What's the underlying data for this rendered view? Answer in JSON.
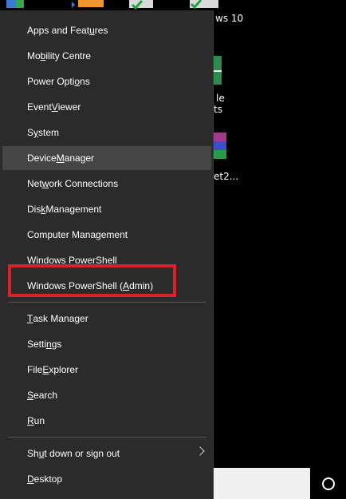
{
  "desktop": {
    "labels": [
      "ws 10",
      "le",
      "ts",
      "et2..."
    ]
  },
  "menu": {
    "items": [
      {
        "id": "apps-and-features",
        "pre": "Apps and Feat",
        "u": "u",
        "post": "res"
      },
      {
        "id": "mobility-centre",
        "pre": "Mo",
        "u": "b",
        "post": "ility Centre"
      },
      {
        "id": "power-options",
        "pre": "Power Opti",
        "u": "o",
        "post": "ns"
      },
      {
        "id": "event-viewer",
        "pre": "Event ",
        "u": "V",
        "post": "iewer"
      },
      {
        "id": "system",
        "pre": "S",
        "u": "y",
        "post": "stem"
      },
      {
        "id": "device-manager",
        "pre": "Device ",
        "u": "M",
        "post": "anager"
      },
      {
        "id": "network-connections",
        "pre": "Net",
        "u": "w",
        "post": "ork Connections"
      },
      {
        "id": "disk-management",
        "pre": "Dis",
        "u": "k",
        "post": " Management"
      },
      {
        "id": "computer-management",
        "pre": "Computer Mana",
        "u": "g",
        "post": "ement"
      },
      {
        "id": "windows-powershell",
        "pre": "Windows Power",
        "u": "S",
        "post": "hell"
      },
      {
        "id": "windows-powershell-admin",
        "pre": "Windows PowerShell (",
        "u": "A",
        "post": "dmin)"
      },
      {
        "id": "task-manager",
        "pre": "",
        "u": "T",
        "post": "ask Manager"
      },
      {
        "id": "settings",
        "pre": "Setti",
        "u": "n",
        "post": "gs"
      },
      {
        "id": "file-explorer",
        "pre": "File ",
        "u": "E",
        "post": "xplorer"
      },
      {
        "id": "search",
        "pre": "",
        "u": "S",
        "post": "earch"
      },
      {
        "id": "run",
        "pre": "",
        "u": "R",
        "post": "un"
      },
      {
        "id": "shut-down-or-sign-out",
        "pre": "Sh",
        "u": "u",
        "post": "t down or sign out"
      },
      {
        "id": "desktop",
        "pre": "",
        "u": "D",
        "post": "esktop"
      }
    ]
  }
}
